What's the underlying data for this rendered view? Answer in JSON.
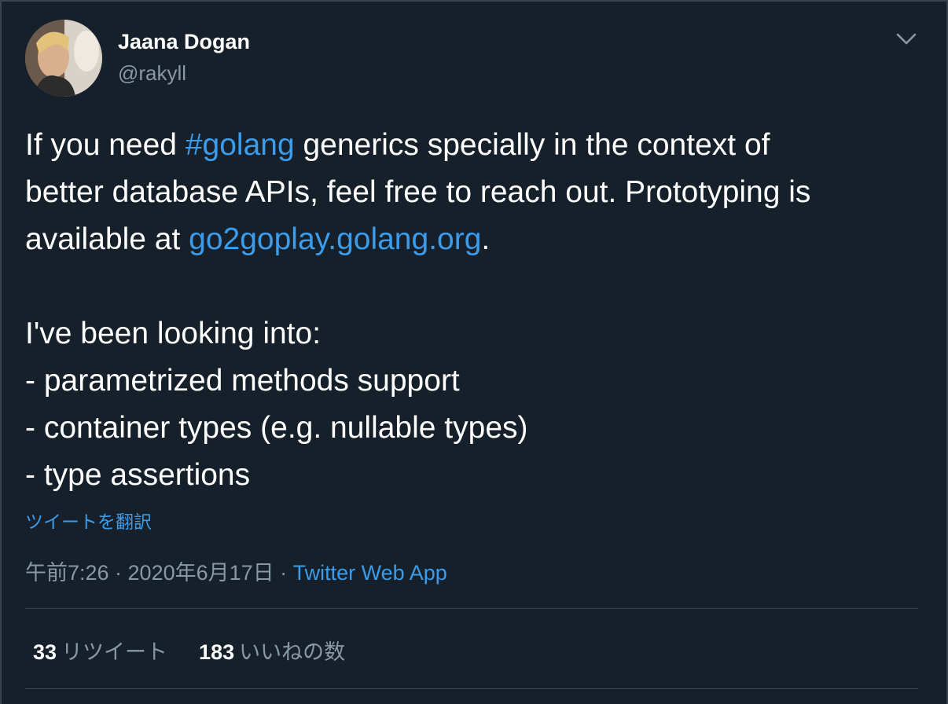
{
  "user": {
    "display_name": "Jaana Dogan",
    "handle": "@rakyll"
  },
  "tweet": {
    "line1_before": "If you need ",
    "hashtag": "#golang",
    "line1_after": " generics specially in the context of",
    "line2": "better database APIs, feel free to reach out. Prototyping is",
    "line3_before": "available at ",
    "link": "go2goplay.golang.org",
    "line3_after": ".",
    "line5": "I've been looking into:",
    "line6": "- parametrized methods support",
    "line7": "- container types (e.g. nullable types)",
    "line8": "- type assertions"
  },
  "translate_label": "ツイートを翻訳",
  "meta": {
    "timestamp": "午前7:26 · 2020年6月17日 · ",
    "app": "Twitter Web App"
  },
  "stats": {
    "retweets_count": "33",
    "retweets_label": "リツイート",
    "likes_count": "183",
    "likes_label": "いいねの数"
  },
  "colors": {
    "background": "#15202b",
    "accent": "#3c9cea",
    "secondary_text": "#8899a6",
    "divider": "#38444d"
  },
  "icons": {
    "caret": "chevron-down-icon",
    "avatar": "avatar"
  }
}
